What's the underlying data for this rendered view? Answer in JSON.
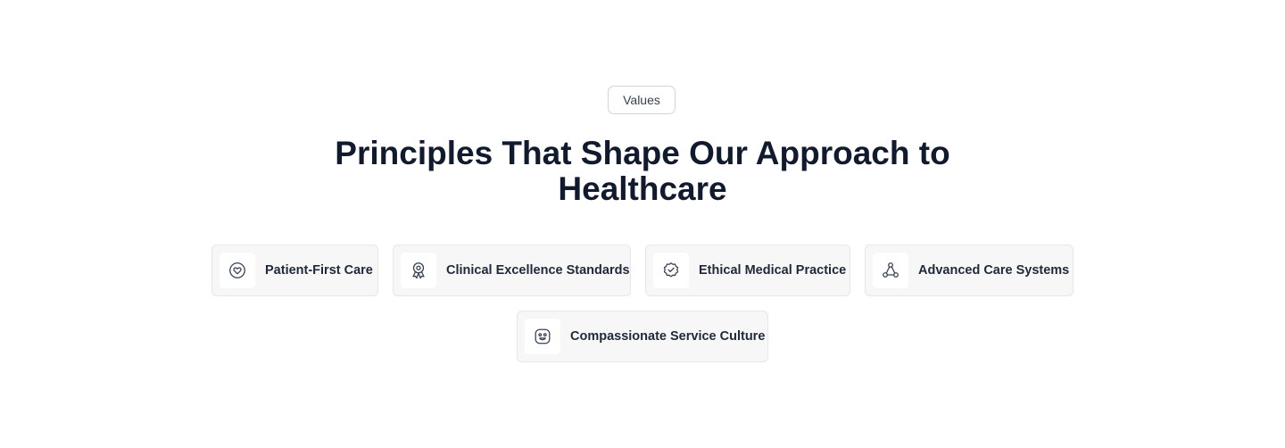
{
  "badge": {
    "label": "Values"
  },
  "heading": {
    "title": "Principles That Shape Our Approach to Healthcare"
  },
  "values": [
    {
      "label": "Patient-First Care",
      "icon": "heart-circle-icon"
    },
    {
      "label": "Clinical Excellence Standards",
      "icon": "award-icon"
    },
    {
      "label": "Ethical Medical Practice",
      "icon": "badge-check-icon"
    },
    {
      "label": "Advanced Care Systems",
      "icon": "network-icon"
    },
    {
      "label": "Compassionate Service Culture",
      "icon": "smile-face-icon"
    }
  ]
}
